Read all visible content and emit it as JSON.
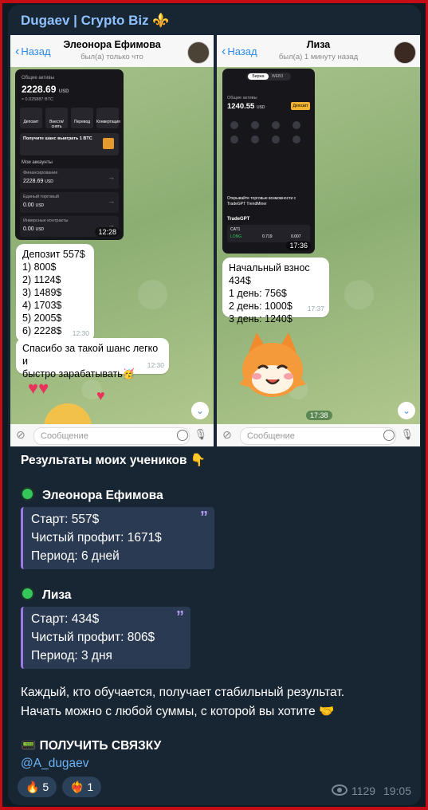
{
  "channel": {
    "title": "Dugaev | Crypto Biz",
    "title_emoji": "⚜️"
  },
  "screenshots": {
    "left": {
      "back_label": "Назад",
      "contact_name": "Элеонора Ефимова",
      "status": "был(а) только что",
      "wallet": {
        "total_label": "Общие активы",
        "balance": "2228.69",
        "currency": "USD",
        "sub_balance": "≈ 0.025887 BTC",
        "actions": [
          "Депозит",
          "Внести/снять",
          "Перевод",
          "Конвертация"
        ],
        "promo": "Получите шанс выиграть 1 BTC",
        "accounts_title": "Мои аккаунты",
        "accounts": [
          {
            "name": "Финансирование",
            "value": "2228.69",
            "unit": "USD"
          },
          {
            "name": "Единый торговый",
            "value": "0.00",
            "unit": "USD"
          },
          {
            "name": "Инверсные контракты",
            "value": "0.00",
            "unit": "USD"
          }
        ],
        "time": "12:28"
      },
      "messages": [
        {
          "lines": [
            "Депозит 557$",
            "1) 800$",
            "2) 1124$",
            "3) 1489$",
            "4) 1703$",
            "5) 2005$",
            "6) 2228$"
          ],
          "time": "12:30"
        },
        {
          "lines": [
            "Спасибо за такой шанс легко и",
            "быстро зарабатывать🥳"
          ],
          "time": "12:30"
        }
      ],
      "input_placeholder": "Сообщение"
    },
    "right": {
      "back_label": "Назад",
      "contact_name": "Лиза",
      "status": "был(а) 1 минуту назад",
      "wallet": {
        "tabs": [
          "Биржа",
          "WEB3"
        ],
        "total_label": "Общие активы",
        "balance": "1240.55",
        "currency": "USD",
        "deposit_button": "Депозит",
        "promo": "Открывайте торговые возможности с TradeGPT TrendMiner",
        "section": "TradeGPT",
        "ticker": "CAT1",
        "ticker_side": "LONG",
        "ticker_values": [
          "0.719",
          "0.007"
        ],
        "time": "17:36"
      },
      "messages": [
        {
          "lines": [
            "Начальный взнос 434$",
            "1 день: 756$",
            "2 день: 1000$",
            "3 день: 1240$"
          ],
          "time": "17:37"
        }
      ],
      "sticker_time": "17:38",
      "input_placeholder": "Сообщение"
    }
  },
  "post": {
    "heading": "Результаты моих учеников 👇",
    "students": [
      {
        "name": "Элеонора Ефимова",
        "lines": [
          "Старт: 557$",
          "Чистый профит: 1671$",
          "Период: 6 дней"
        ]
      },
      {
        "name": "Лиза",
        "lines": [
          "Старт: 434$",
          "Чистый профит: 806$",
          "Период: 3 дня"
        ]
      }
    ],
    "summary_1": "Каждый, кто обучается, получает стабильный результат.",
    "summary_2": "Начать можно с любой суммы, с которой вы хотите 🤝",
    "cta": "📟 ПОЛУЧИТЬ СВЯЗКУ",
    "link": "@A_dugaev"
  },
  "reactions": [
    {
      "emoji": "🔥",
      "count": "5"
    },
    {
      "emoji": "❤️‍🔥",
      "count": "1"
    }
  ],
  "views": "1129",
  "time": "19:05",
  "colors": {
    "accent": "#8fc1ff",
    "bubble": "#182533",
    "background": "#0f1a22",
    "quote_bar": "#9a7ae8",
    "online_dot": "#35c759"
  }
}
